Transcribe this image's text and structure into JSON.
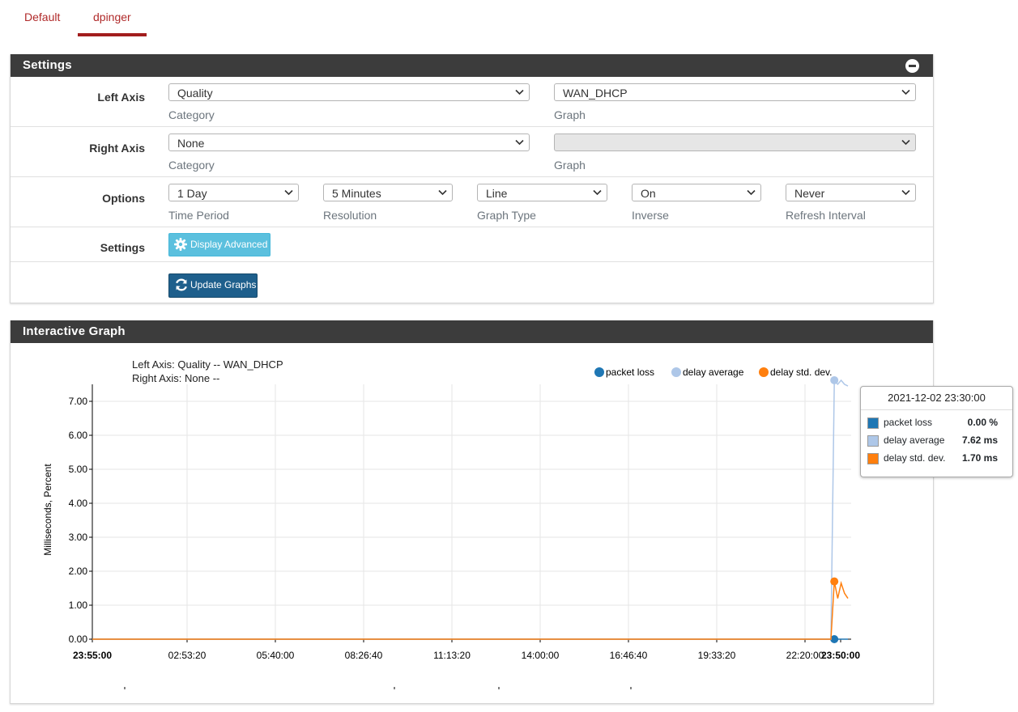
{
  "tabs": [
    {
      "label": "Default",
      "active": false
    },
    {
      "label": "dpinger",
      "active": true
    }
  ],
  "settings_panel": {
    "title": "Settings",
    "left_axis": {
      "label": "Left Axis",
      "category": {
        "value": "Quality",
        "help": "Category"
      },
      "graph": {
        "value": "WAN_DHCP",
        "help": "Graph"
      }
    },
    "right_axis": {
      "label": "Right Axis",
      "category": {
        "value": "None",
        "help": "Category"
      },
      "graph": {
        "value": "",
        "help": "Graph"
      }
    },
    "options": {
      "label": "Options",
      "time_period": {
        "value": "1 Day",
        "help": "Time Period"
      },
      "resolution": {
        "value": "5 Minutes",
        "help": "Resolution"
      },
      "graph_type": {
        "value": "Line",
        "help": "Graph Type"
      },
      "inverse": {
        "value": "On",
        "help": "Inverse"
      },
      "refresh": {
        "value": "Never",
        "help": "Refresh Interval"
      }
    },
    "settings_row": {
      "label": "Settings",
      "display_advanced": "Display Advanced"
    },
    "update_button": "Update Graphs"
  },
  "graph_panel": {
    "title": "Interactive Graph",
    "header_left": "Left Axis: Quality -- WAN_DHCP",
    "header_right": "Right Axis: None --",
    "tooltip": {
      "time": "2021-12-02 23:30:00",
      "rows": [
        {
          "name": "packet loss",
          "value": "0.00 %"
        },
        {
          "name": "delay average",
          "value": "7.62 ms"
        },
        {
          "name": "delay std. dev.",
          "value": "1.70 ms"
        }
      ]
    }
  },
  "colors": {
    "brand_red": "#a21d1d",
    "panel_header": "#3c3c3c",
    "packet_loss": "#1f77b4",
    "delay_average": "#aec7e8",
    "delay_stddev": "#ff7f0e"
  },
  "chart_data": {
    "type": "line",
    "ylabel": "Milliseconds, Percent",
    "ylim": [
      0,
      7.5
    ],
    "yticks": [
      "0.00",
      "1.00",
      "2.00",
      "3.00",
      "4.00",
      "5.00",
      "6.00",
      "7.00"
    ],
    "xticks": [
      "23:55:00",
      "02:53:20",
      "05:40:00",
      "08:26:40",
      "11:13:20",
      "14:00:00",
      "16:46:40",
      "19:33:20",
      "22:20:00",
      "23:50:00"
    ],
    "xticks_bold": [
      "23:55:00",
      "23:50:00"
    ],
    "legend": {
      "position": "top-right",
      "entries": [
        "packet loss",
        "delay average",
        "delay std. dev."
      ]
    },
    "grid": true,
    "series": [
      {
        "name": "packet loss",
        "color": "#1f77b4",
        "points": [
          [
            "23:55:00",
            0
          ],
          [
            "23:25:00",
            0
          ],
          [
            "23:30:00",
            0
          ],
          [
            "23:35:00",
            0
          ],
          [
            "23:40:00",
            0
          ],
          [
            "23:45:00",
            0
          ],
          [
            "23:50:00",
            0
          ]
        ]
      },
      {
        "name": "delay average",
        "color": "#aec7e8",
        "points": [
          [
            "23:55:00",
            0
          ],
          [
            "23:25:00",
            0
          ],
          [
            "23:30:00",
            7.62
          ],
          [
            "23:35:00",
            7.5
          ],
          [
            "23:40:00",
            7.62
          ],
          [
            "23:45:00",
            7.5
          ],
          [
            "23:50:00",
            7.45
          ]
        ]
      },
      {
        "name": "delay std. dev.",
        "color": "#ff7f0e",
        "points": [
          [
            "23:55:00",
            0
          ],
          [
            "23:25:00",
            0
          ],
          [
            "23:30:00",
            1.7
          ],
          [
            "23:35:00",
            1.2
          ],
          [
            "23:40:00",
            1.65
          ],
          [
            "23:45:00",
            1.35
          ],
          [
            "23:50:00",
            1.2
          ]
        ]
      }
    ],
    "highlight_x": "23:30:00"
  }
}
